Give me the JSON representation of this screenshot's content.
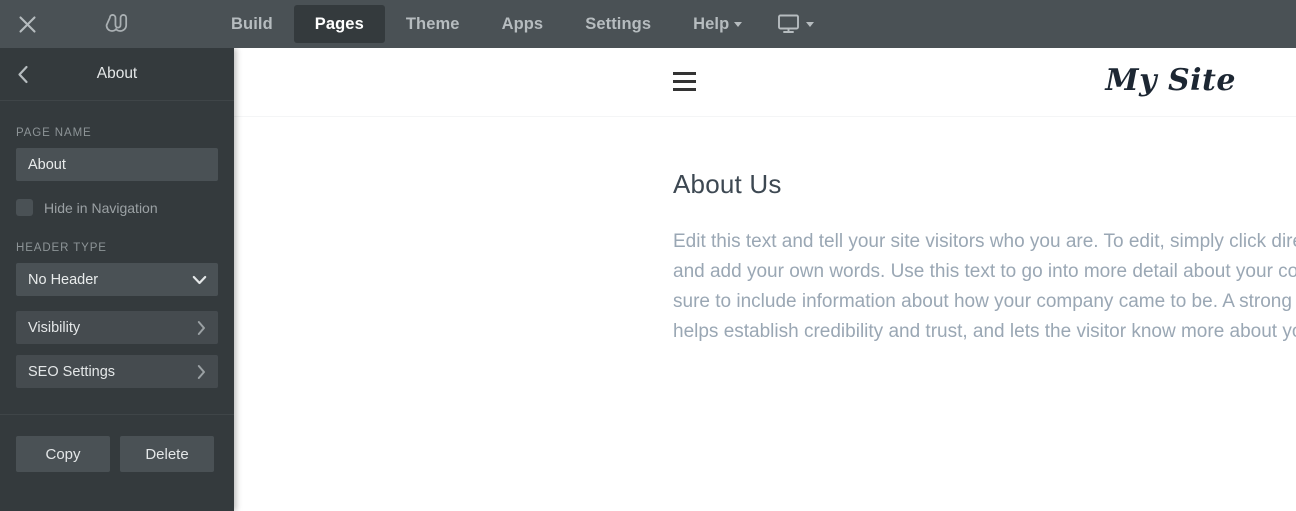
{
  "toolbar": {
    "close_icon": "close-icon",
    "logo_icon": "weebly-logo",
    "items": [
      {
        "label": "Build",
        "active": false
      },
      {
        "label": "Pages",
        "active": true
      },
      {
        "label": "Theme",
        "active": false
      },
      {
        "label": "Apps",
        "active": false
      },
      {
        "label": "Settings",
        "active": false
      }
    ],
    "help_label": "Help",
    "device_icon": "desktop-monitor-icon"
  },
  "sidebar": {
    "back_icon": "chevron-left-icon",
    "title": "About",
    "page_name_label": "PAGE NAME",
    "page_name_value": "About",
    "page_name_placeholder": "Page name",
    "hide_in_nav_label": "Hide in Navigation",
    "hide_in_nav_checked": false,
    "header_type_label": "HEADER TYPE",
    "header_type_value": "No Header",
    "rows": [
      {
        "label": "Visibility"
      },
      {
        "label": "SEO Settings"
      }
    ],
    "copy_label": "Copy",
    "delete_label": "Delete"
  },
  "preview": {
    "menu_icon": "hamburger-menu-icon",
    "site_title": "My Site",
    "heading": "About Us",
    "paragraph": "Edit this text and tell your site visitors who you are. To edit, simply click directly on the text and add your own words. Use this text to go into more detail about your company. Make sure to include information about how your company came to be. A strong “About” page helps establish credibility and trust, and lets the visitor know more about you."
  },
  "colors": {
    "toolbar_bg": "#4a5155",
    "sidebar_bg": "#343a3d",
    "active_tab_bg": "#343a3d",
    "field_bg": "#4a5155",
    "canvas_bg": "#ffffff",
    "body_text": "#9aa7b4",
    "heading_text": "#3d4852"
  }
}
